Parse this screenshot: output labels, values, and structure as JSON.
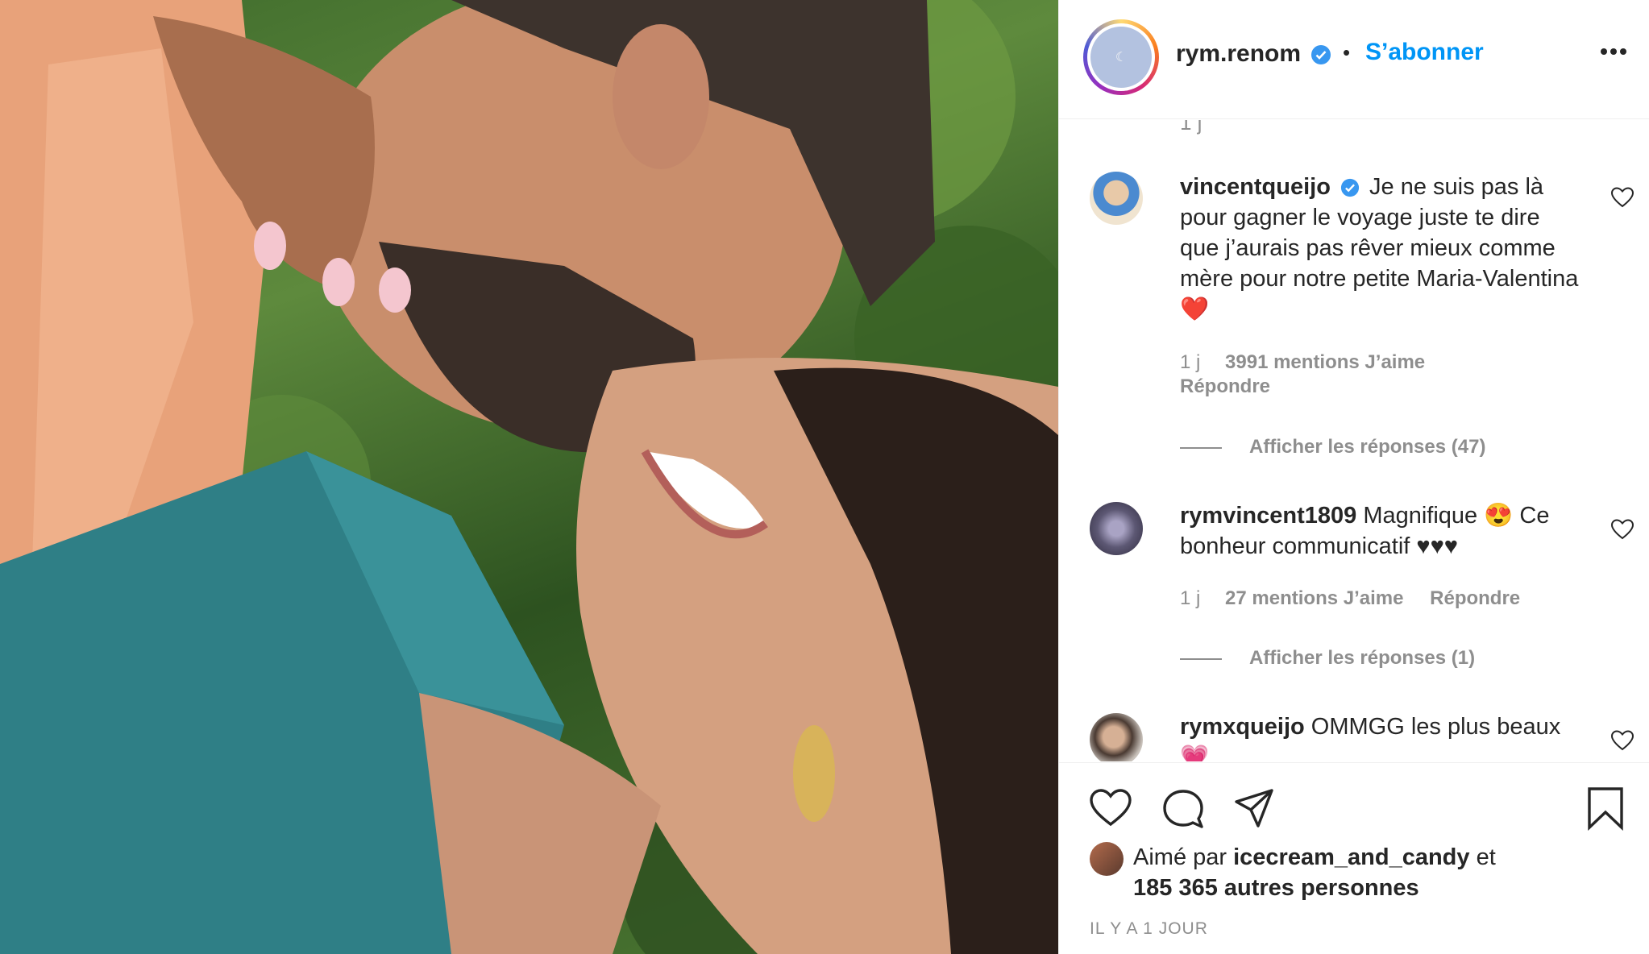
{
  "photo": {
    "alt_name": "couple-photo"
  },
  "header": {
    "username": "rym.renom",
    "separator": "•",
    "follow_label": "S’abonner",
    "verified_icon": "verified-badge-icon",
    "more_icon": "more-options-icon"
  },
  "comments_partial_text": "1 j",
  "comments": [
    {
      "username": "vincentqueijo",
      "verified": true,
      "text": "Je ne suis pas là pour gagner le voyage juste te dire que j’aurais pas rêver mieux comme mère pour notre petite Maria-Valentina",
      "emoji": "❤️",
      "time": "1 j",
      "likes": "3991 mentions J’aime",
      "reply": "Répondre",
      "view_replies": "Afficher les réponses (47)"
    },
    {
      "username": "rymvincent1809",
      "verified": false,
      "text": "Magnifique",
      "emoji": "😍",
      "text2": "Ce bonheur communicatif ♥♥♥",
      "time": "1 j",
      "likes": "27 mentions J’aime",
      "reply": "Répondre",
      "view_replies": "Afficher les réponses (1)"
    },
    {
      "username": "rymxqueijo",
      "verified": false,
      "text": "OMMGG les plus beaux 💗"
    }
  ],
  "actions": {
    "like_icon": "heart-icon",
    "comment_icon": "comment-icon",
    "share_icon": "share-icon",
    "save_icon": "bookmark-icon"
  },
  "likes_summary": {
    "prefix": "Aimé par",
    "user": "icecream_and_candy",
    "middle": "et",
    "others": "185 365 autres personnes"
  },
  "timestamp": "IL Y A 1 JOUR",
  "colors": {
    "link_blue": "#0095f6",
    "verified_blue": "#3897f0",
    "muted": "#8e8e8e",
    "text": "#262626"
  }
}
